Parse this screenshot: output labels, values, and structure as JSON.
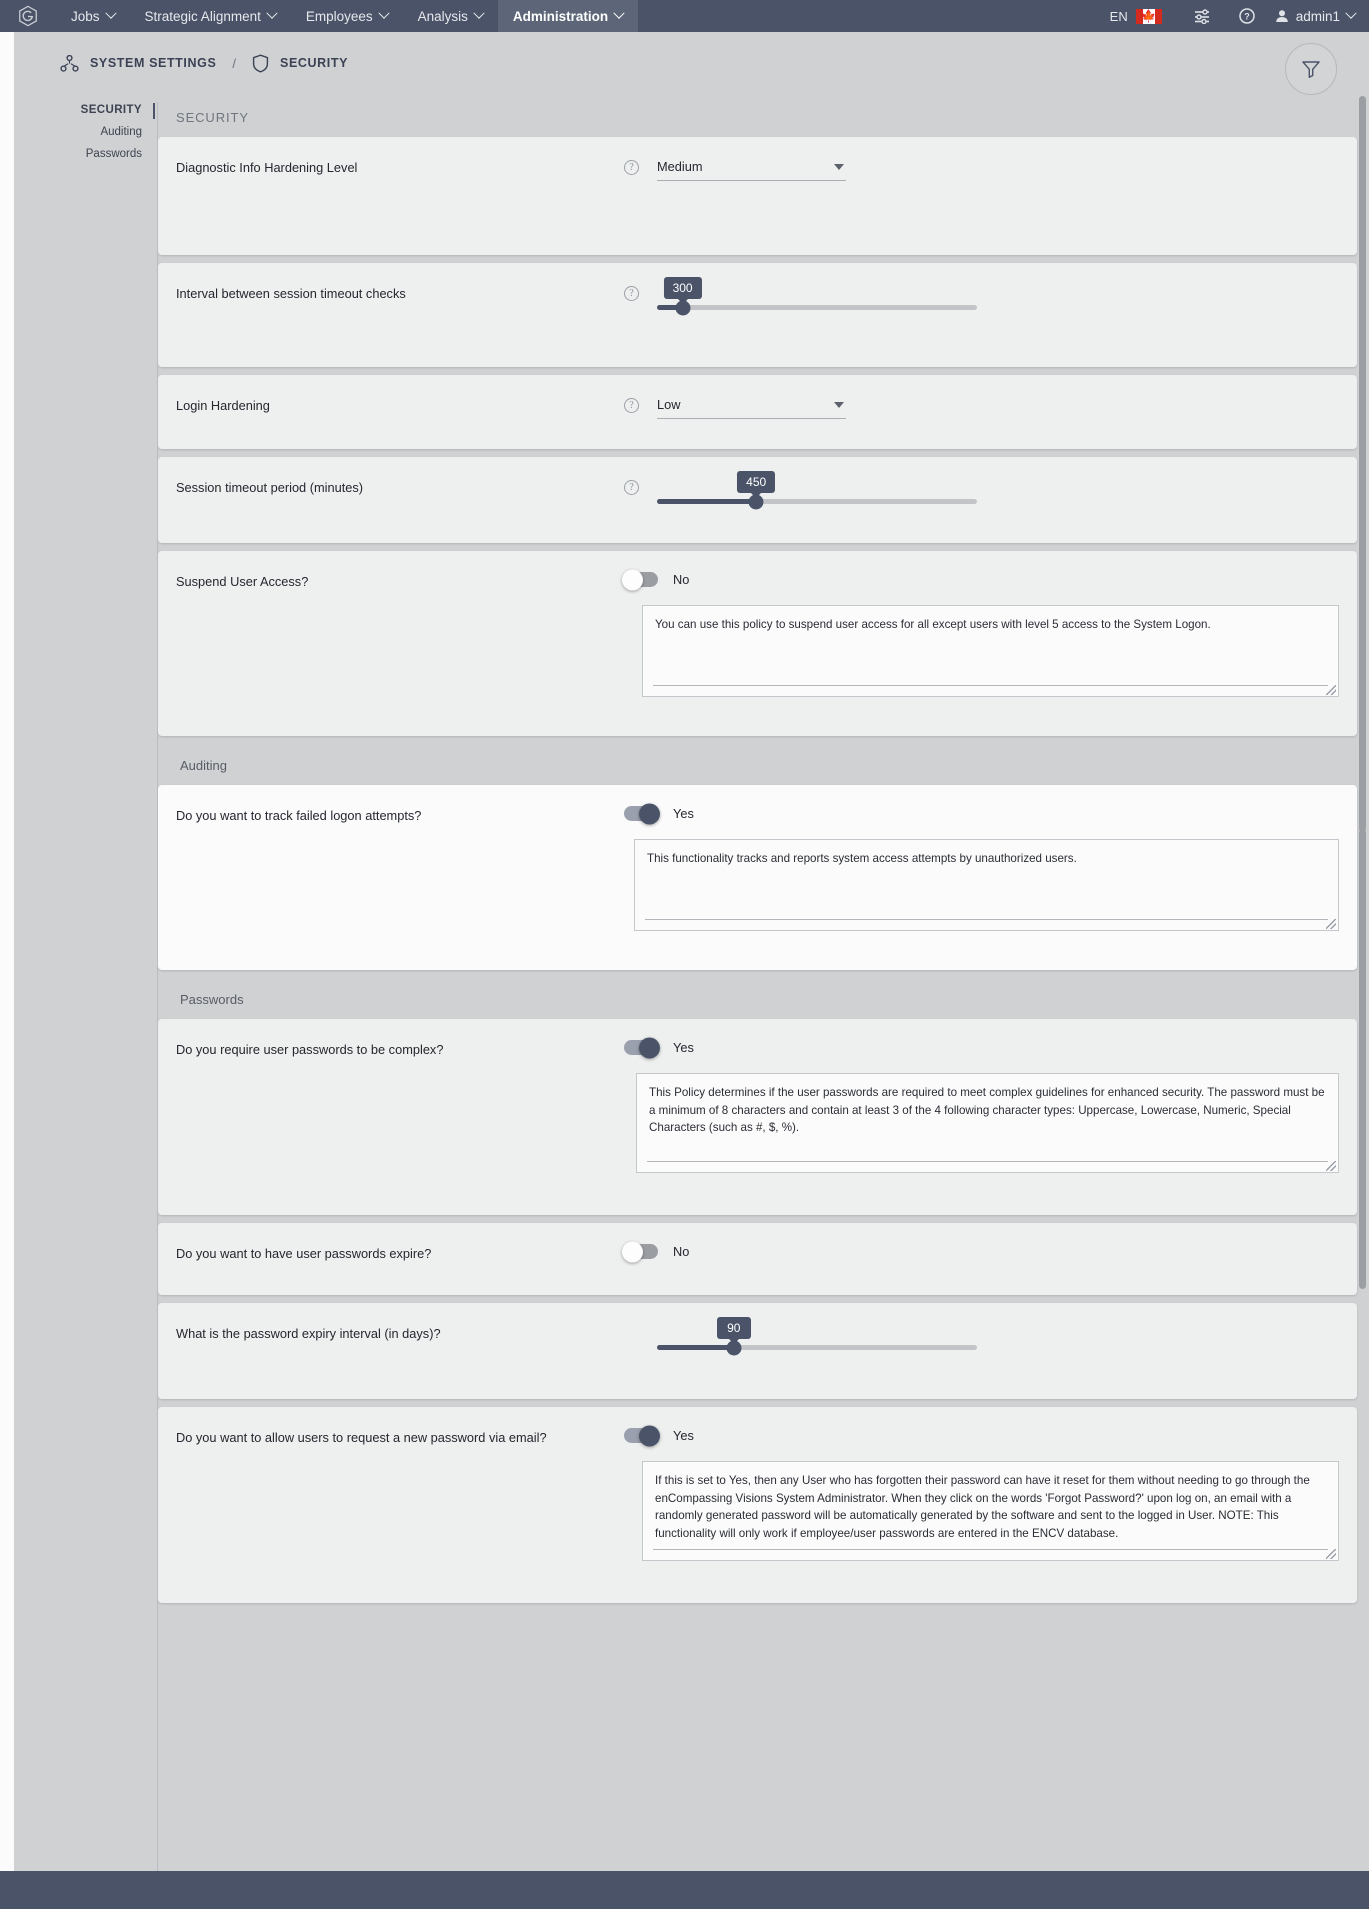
{
  "topnav": {
    "logo_name": "encompassing-visions-logo",
    "items": [
      {
        "label": "Jobs",
        "has_caret": true,
        "active": false
      },
      {
        "label": "Strategic Alignment",
        "has_caret": true,
        "active": false
      },
      {
        "label": "Employees",
        "has_caret": true,
        "active": false
      },
      {
        "label": "Analysis",
        "has_caret": true,
        "active": false
      },
      {
        "label": "Administration",
        "has_caret": true,
        "active": true
      }
    ],
    "language": "EN",
    "flag": "canada-flag",
    "settings_icon": "sliders-icon",
    "help_icon": "question-circle-icon",
    "user": "admin1"
  },
  "breadcrumb": {
    "items": [
      {
        "label": "SYSTEM SETTINGS",
        "icon": "org-chart-icon"
      },
      {
        "label": "SECURITY",
        "icon": "shield-icon"
      }
    ],
    "separator": "/",
    "filter_icon": "funnel-icon"
  },
  "sidebar": {
    "items": [
      {
        "label": "SECURITY",
        "active": true
      },
      {
        "label": "Auditing",
        "active": false
      },
      {
        "label": "Passwords",
        "active": false
      }
    ]
  },
  "main": {
    "section_title": "SECURITY",
    "groups": [
      {
        "heading": null,
        "cards": [
          {
            "label": "Diagnostic Info Hardening Level",
            "type": "select",
            "value": "Medium",
            "help": "?",
            "white": false
          },
          {
            "label": "Interval between session timeout checks",
            "type": "slider",
            "value": "300",
            "percent": 8,
            "help": "?",
            "white": false
          },
          {
            "label": "Login Hardening",
            "type": "select",
            "value": "Low",
            "help": "?",
            "white": false
          },
          {
            "label": "Session timeout period (minutes)",
            "type": "slider",
            "value": "450",
            "percent": 31,
            "help": "?",
            "white": false
          },
          {
            "label": "Suspend User Access?",
            "type": "toggle",
            "value": "No",
            "on": false,
            "white": false,
            "description": "You can use this policy to suspend user access for all except users with level 5 access to the System Logon."
          }
        ]
      },
      {
        "heading": "Auditing",
        "cards": [
          {
            "label": "Do you want to track failed logon attempts?",
            "type": "toggle",
            "value": "Yes",
            "on": true,
            "white": true,
            "description": "This functionality tracks and reports system access attempts by unauthorized users."
          }
        ]
      },
      {
        "heading": "Passwords",
        "cards": [
          {
            "label": "Do you require user passwords to be complex?",
            "type": "toggle",
            "value": "Yes",
            "on": true,
            "white": false,
            "description": "This Policy determines if the user passwords are required to meet complex guidelines for enhanced security.  The password must be a minimum of 8 characters and contain at least 3 of the 4 following character types: Uppercase, Lowercase, Numeric, Special Characters (such as #, $, %)."
          },
          {
            "label": "Do you want to have user passwords expire?",
            "type": "toggle",
            "value": "No",
            "on": false,
            "white": false,
            "description": null
          },
          {
            "label": "What is the password expiry interval (in days)?",
            "type": "slider",
            "value": "90",
            "percent": 24,
            "white": false
          },
          {
            "label": "Do you want to allow users to request a new password via email?",
            "type": "toggle",
            "value": "Yes",
            "on": true,
            "white": false,
            "description": "If this is set to Yes, then any User who has forgotten their password can have it reset for them without needing to go through the enCompassing Visions System Administrator. When they click on the words 'Forgot Password?' upon log on, an email with a randomly generated password will be automatically generated by the software and sent to the logged in User. NOTE: This functionality will only work if employee/user passwords are entered in the ENCV database."
          }
        ]
      }
    ]
  },
  "colors": {
    "nav_bg": "#4b5368",
    "page_bg": "#cfd1d3",
    "card_bg": "#eeefef",
    "accent": "#4b5368"
  }
}
